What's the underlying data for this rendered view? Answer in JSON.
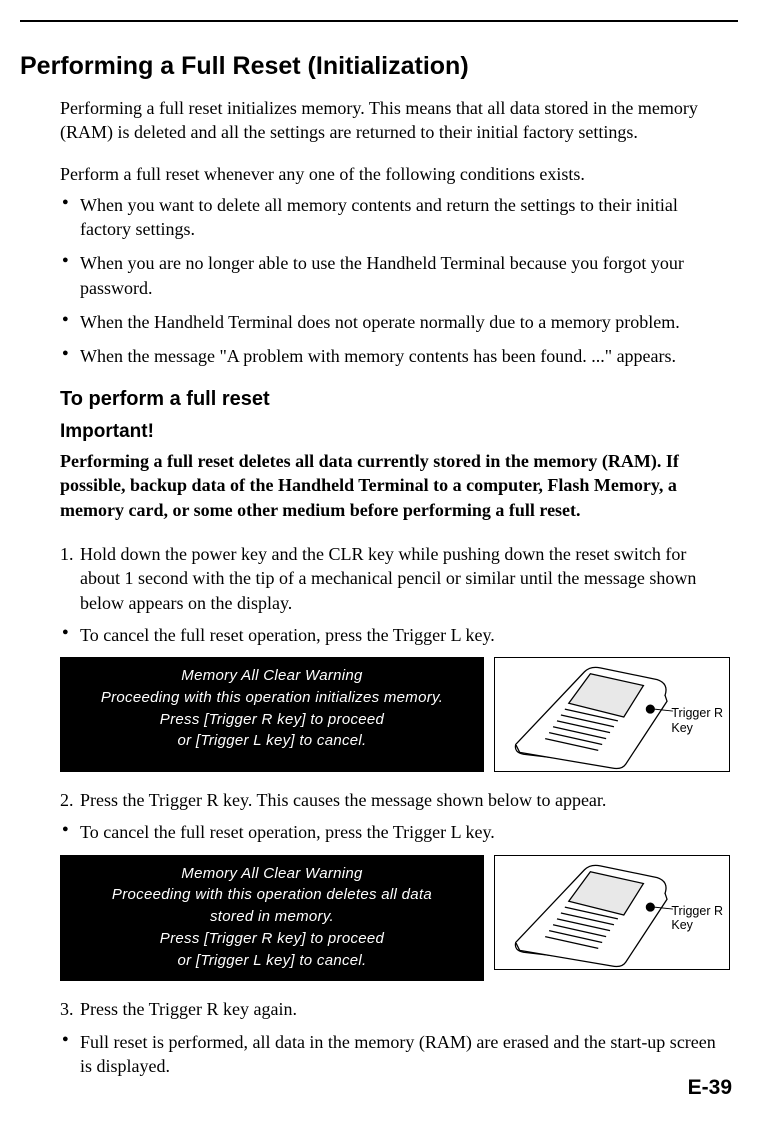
{
  "heading": "Performing a Full Reset (Initialization)",
  "intro1": "Performing a full reset initializes memory. This means that all data stored in the memory (RAM) is deleted and all the settings are returned to their initial factory settings.",
  "intro2": "Perform a full reset whenever any one of the following conditions exists.",
  "conditions": [
    "When you want to delete all memory contents and return the settings to their initial factory settings.",
    "When you are no longer able to use the Handheld Terminal because you forgot your password.",
    "When the Handheld Terminal does not operate normally due to a memory problem.",
    "When the message \"A problem with memory contents has been found. ...\" appears."
  ],
  "sub_heading": "To perform a full reset",
  "important_label": "Important!",
  "important_text": "Performing a full reset deletes all data currently stored in the memory (RAM). If possible, backup data of the Handheld Terminal to a computer, Flash Memory, a memory card, or some other medium before performing a full reset.",
  "step1_num": "1.",
  "step1": "Hold down the power key and the CLR key while pushing down the reset switch for about 1 second with the tip of a mechanical pencil or similar until the message shown below appears on the display.",
  "step1_cancel": "To cancel the full reset operation, press the Trigger L key.",
  "lcd1": {
    "l1": "Memory All Clear Warning",
    "l2": "Proceeding with this operation initializes memory.",
    "l3": "Press [Trigger R key] to proceed",
    "l4": "or [Trigger L key] to cancel."
  },
  "step2_num": "2.",
  "step2": "Press the Trigger R key. This causes the message shown below to appear.",
  "step2_cancel": "To cancel the full reset operation, press the Trigger L key.",
  "lcd2": {
    "l1": "Memory All Clear Warning",
    "l2": "Proceeding with this operation deletes all data",
    "l3": "stored in memory.",
    "l4": "Press [Trigger R key] to proceed",
    "l5": "or [Trigger L key] to cancel."
  },
  "step3_num": "3.",
  "step3": "Press the Trigger R key again.",
  "step3_note": "Full reset is performed, all data in the memory (RAM) are erased and the start-up screen is displayed.",
  "callout": "Trigger R\nKey",
  "page_number": "E-39"
}
